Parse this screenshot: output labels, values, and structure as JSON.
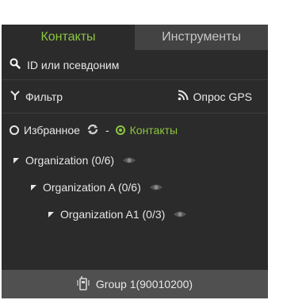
{
  "tabs": [
    {
      "label": "Контакты"
    },
    {
      "label": "Инструменты"
    }
  ],
  "search": {
    "placeholder": "ID или псевдоним",
    "value": ""
  },
  "filter": {
    "label": "Фильтр"
  },
  "gps": {
    "label": "Опрос GPS"
  },
  "view": {
    "favorites_label": "Избранное",
    "separator": "-",
    "contacts_label": "Контакты"
  },
  "tree": [
    {
      "label": "Organization (0/6)"
    },
    {
      "label": "Organization A (0/6)"
    },
    {
      "label": "Organization A1 (0/3)"
    }
  ],
  "group": {
    "label": "Group 1(90010200)"
  },
  "colors": {
    "accent": "#8cc63f",
    "panel_bg": "#2b2b2b",
    "tab_inactive_bg": "#434343",
    "group_row_bg": "#505050"
  }
}
